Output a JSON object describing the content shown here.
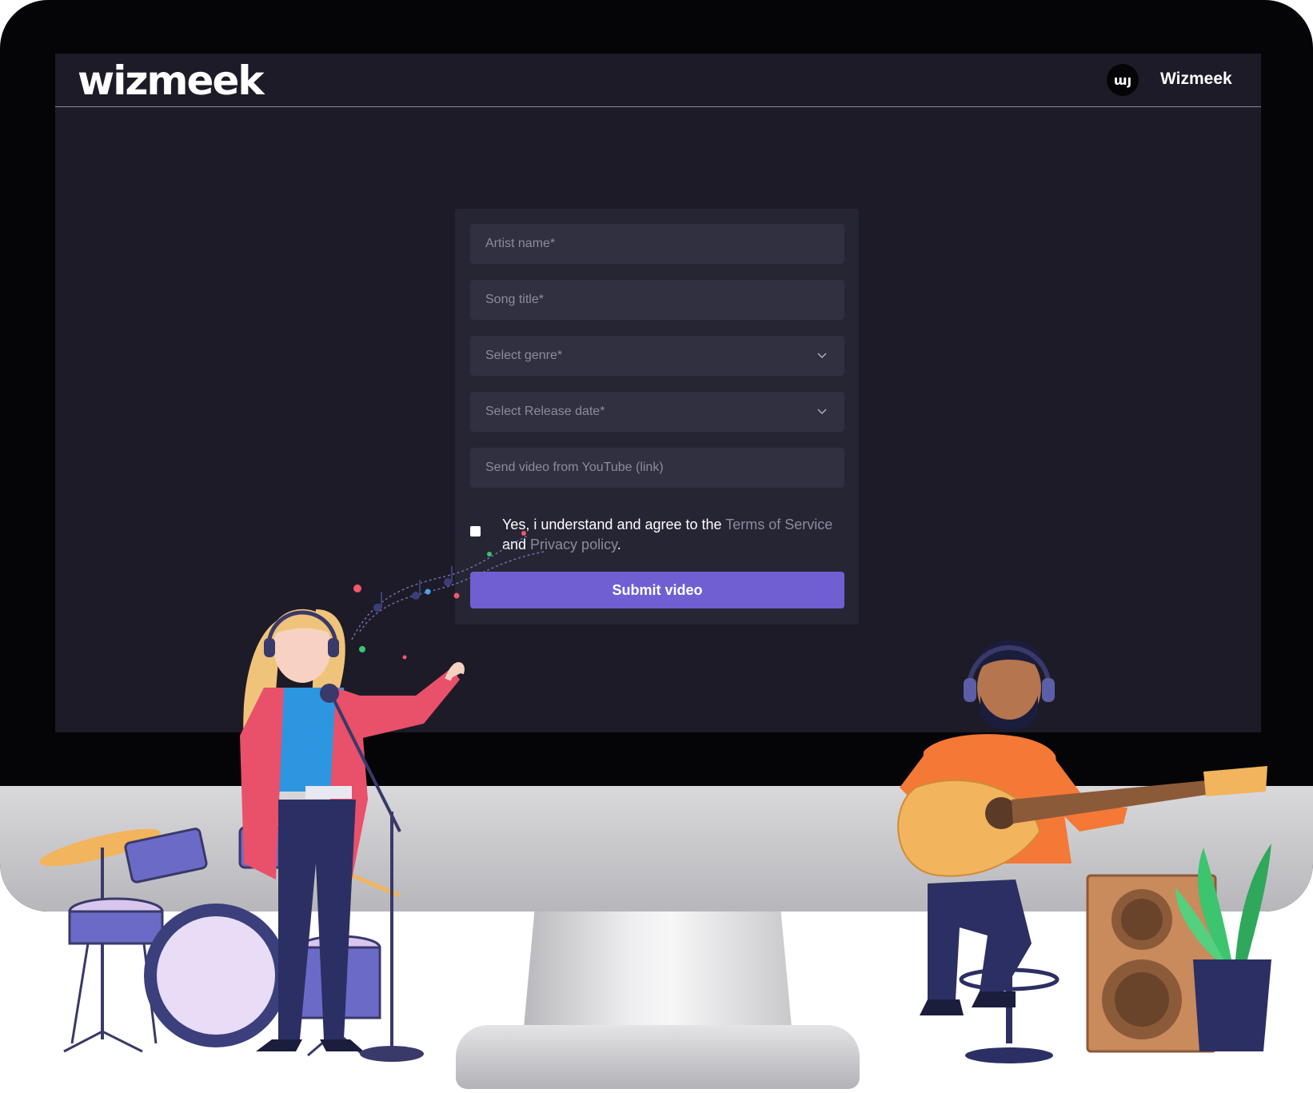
{
  "header": {
    "logo_text": "wizmeek",
    "avatar_initials": "ɯȷ",
    "user_name": "Wizmeek"
  },
  "form": {
    "fields": [
      {
        "placeholder": "Artist name*",
        "type": "text"
      },
      {
        "placeholder": "Song title*",
        "type": "text"
      },
      {
        "placeholder": "Select genre*",
        "type": "select"
      },
      {
        "placeholder": "Select Release date*",
        "type": "select"
      },
      {
        "placeholder": "Send video from YouTube (link)",
        "type": "text"
      }
    ],
    "consent": {
      "prefix": "Yes, i understand and agree to the ",
      "terms_link": "Terms of Service",
      "middle": " and ",
      "privacy_link": "Privacy policy",
      "suffix": ".",
      "checked": false
    },
    "submit_label": "Submit video"
  },
  "colors": {
    "screen_bg": "#1d1b27",
    "card_bg": "#262533",
    "field_bg": "#303040",
    "accent": "#6f5fd3",
    "placeholder": "#8d8b9c"
  },
  "decorations": [
    "singer-illustration",
    "drum-kit-illustration",
    "guitarist-illustration",
    "speaker-illustration",
    "plant-illustration",
    "music-notes-illustration"
  ]
}
